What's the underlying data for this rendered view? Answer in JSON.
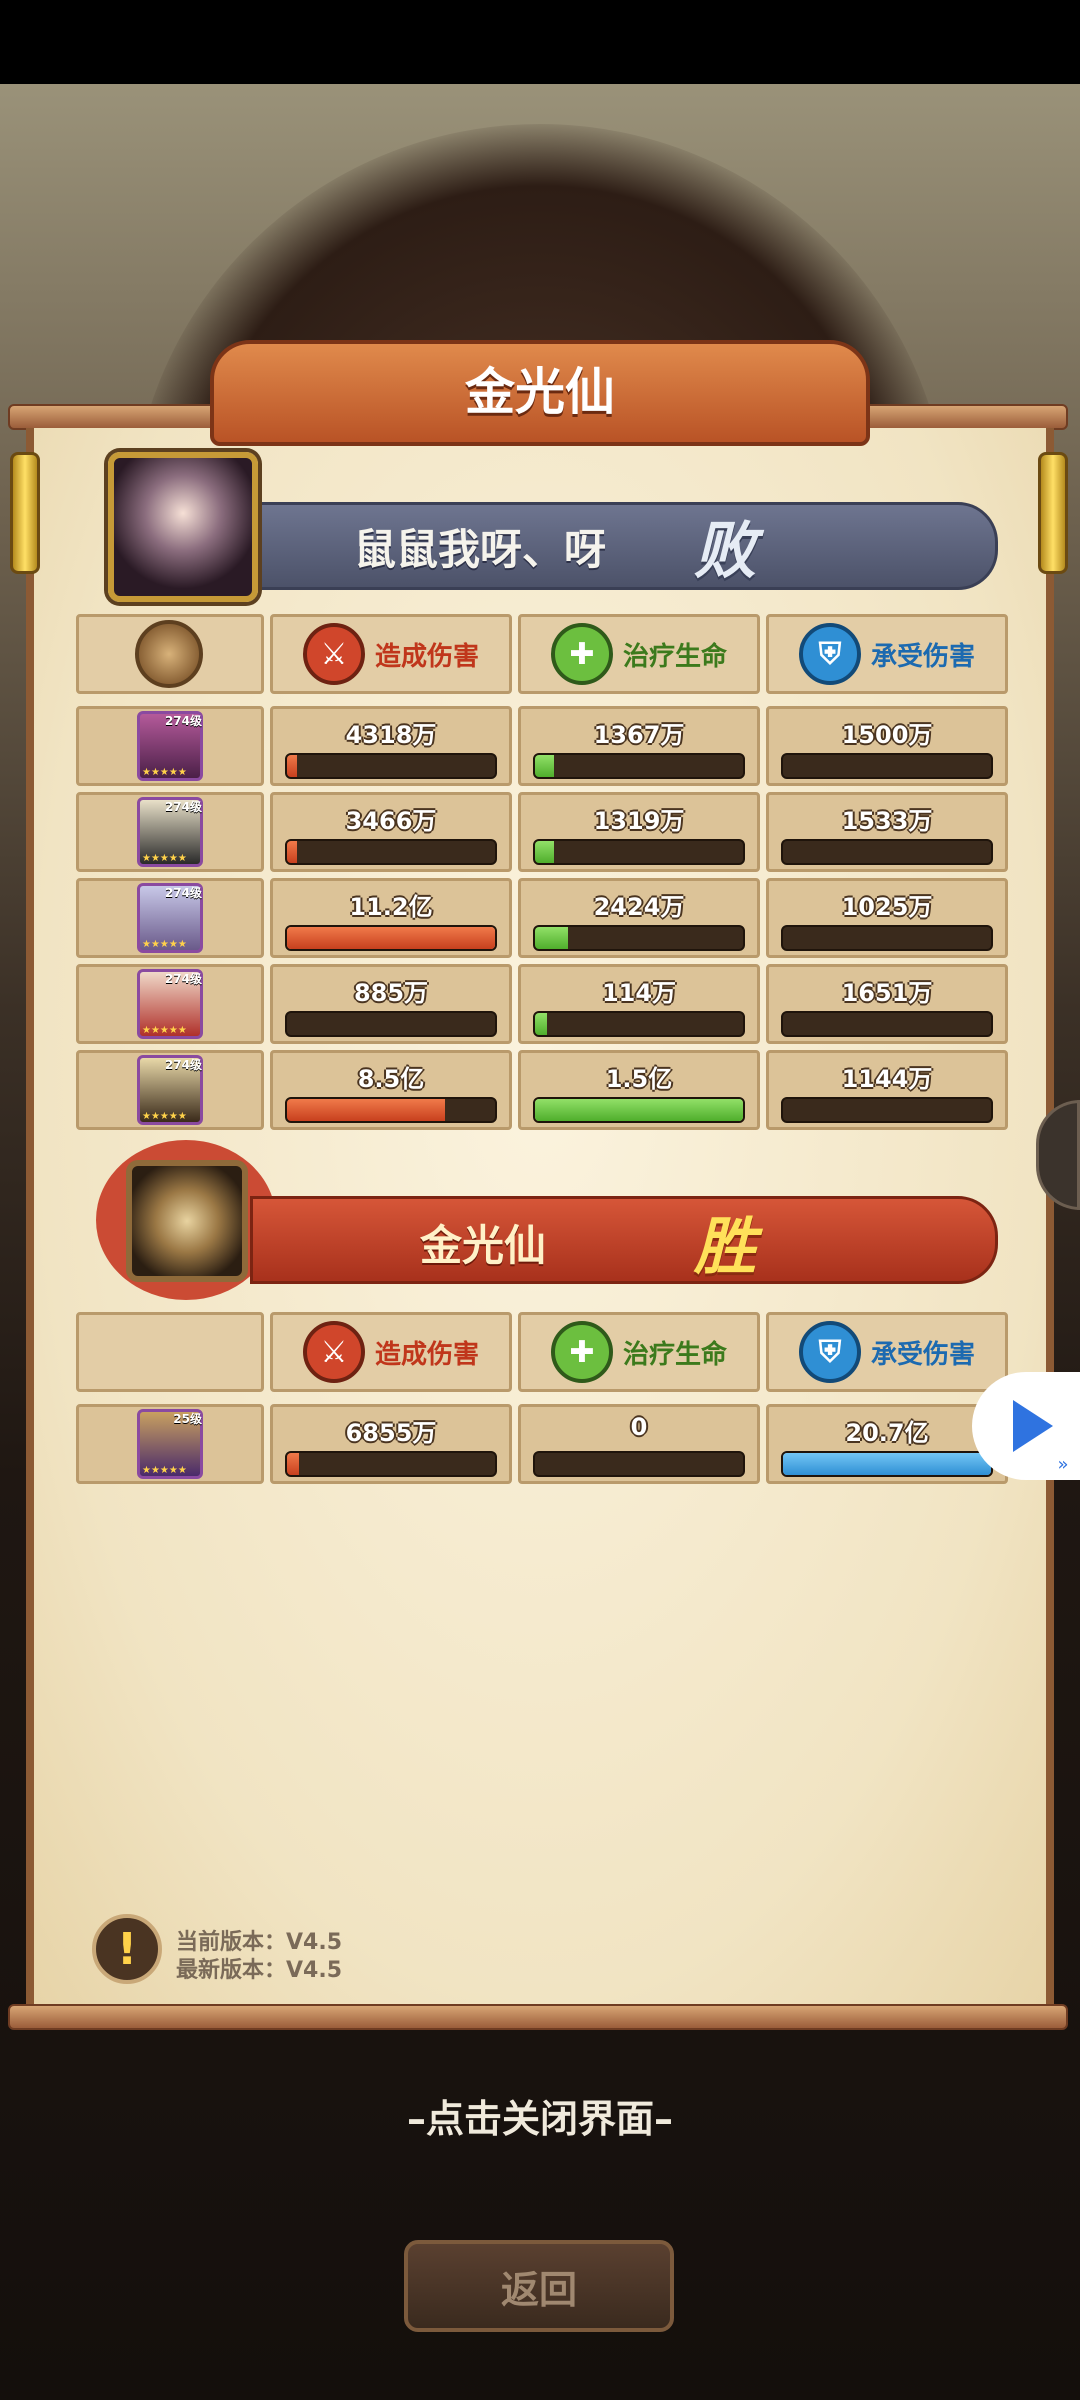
{
  "title": "金光仙",
  "losing_team": {
    "name": "鼠鼠我呀、呀",
    "result": "败",
    "headers": {
      "damage": "造成伤害",
      "heal": "治疗生命",
      "taken": "承受伤害"
    },
    "rows": [
      {
        "level": "274级",
        "damage": "4318万",
        "damage_fill": 0.04,
        "heal": "1367万",
        "heal_fill": 0.09,
        "taken": "1500万",
        "taken_fill": 0.0
      },
      {
        "level": "274级",
        "damage": "3466万",
        "damage_fill": 0.03,
        "heal": "1319万",
        "heal_fill": 0.09,
        "taken": "1533万",
        "taken_fill": 0.0
      },
      {
        "level": "274级",
        "damage": "11.2亿",
        "damage_fill": 1.0,
        "heal": "2424万",
        "heal_fill": 0.16,
        "taken": "1025万",
        "taken_fill": 0.0
      },
      {
        "level": "274级",
        "damage": "885万",
        "damage_fill": 0.0,
        "heal": "114万",
        "heal_fill": 0.01,
        "taken": "1651万",
        "taken_fill": 0.0
      },
      {
        "level": "274级",
        "damage": "8.5亿",
        "damage_fill": 0.76,
        "heal": "1.5亿",
        "heal_fill": 1.0,
        "taken": "1144万",
        "taken_fill": 0.0
      }
    ]
  },
  "winning_team": {
    "name": "金光仙",
    "result": "胜",
    "headers": {
      "damage": "造成伤害",
      "heal": "治疗生命",
      "taken": "承受伤害"
    },
    "rows": [
      {
        "level": "25级",
        "damage": "6855万",
        "damage_fill": 0.06,
        "heal": "0",
        "heal_fill": 0.0,
        "taken": "20.7亿",
        "taken_fill": 1.0
      }
    ]
  },
  "version": {
    "current": "当前版本：V4.5",
    "latest": "最新版本：V4.5"
  },
  "close_hint": "–点击关闭界面–",
  "back_button": "返回",
  "icons": {
    "damage": "sword-icon",
    "heal": "heart-plus-icon",
    "taken": "shield-icon",
    "play": "play-icon"
  },
  "colors": {
    "damage": "#d0462b",
    "heal": "#6cbf3f",
    "taken": "#2f8fd4",
    "lose_banner": "#5c6380",
    "win_banner": "#c0432a"
  }
}
